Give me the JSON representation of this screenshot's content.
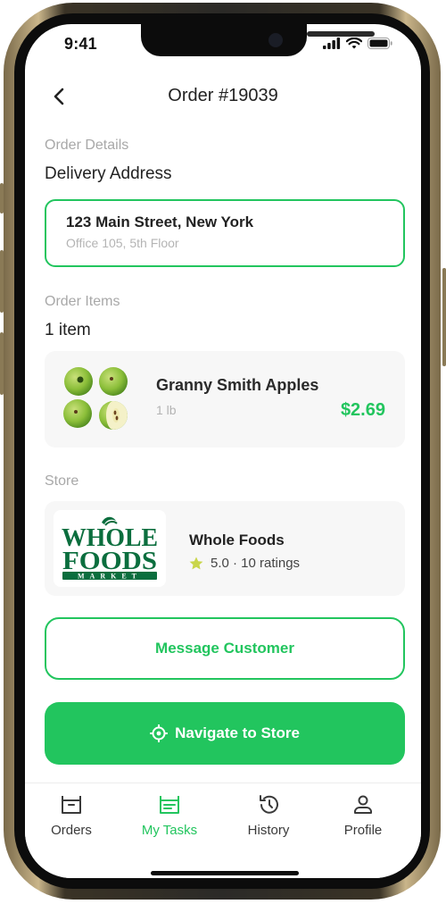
{
  "status_bar": {
    "time": "9:41"
  },
  "header": {
    "title": "Order #19039"
  },
  "order_details": {
    "section_label": "Order Details",
    "heading": "Delivery Address",
    "address_line1": "123 Main Street, New York",
    "address_line2": "Office 105, 5th Floor"
  },
  "order_items": {
    "section_label": "Order Items",
    "heading": "1 item",
    "items": [
      {
        "name": "Granny Smith Apples",
        "quantity": "1 lb",
        "price": "$2.69"
      }
    ]
  },
  "store": {
    "section_label": "Store",
    "name": "Whole Foods",
    "rating": "5.0 · 10 ratings",
    "logo_text": [
      "WHOLE",
      "FOODS",
      "MARKET"
    ]
  },
  "actions": {
    "message_label": "Message Customer",
    "navigate_label": "Navigate to Store"
  },
  "tabbar": {
    "tabs": [
      {
        "label": "Orders",
        "icon": "orders-icon"
      },
      {
        "label": "My Tasks",
        "icon": "tasks-icon",
        "active": true
      },
      {
        "label": "History",
        "icon": "history-icon"
      },
      {
        "label": "Profile",
        "icon": "profile-icon"
      }
    ]
  },
  "colors": {
    "accent": "#22c55e",
    "logo_green": "#0b6e3e"
  }
}
